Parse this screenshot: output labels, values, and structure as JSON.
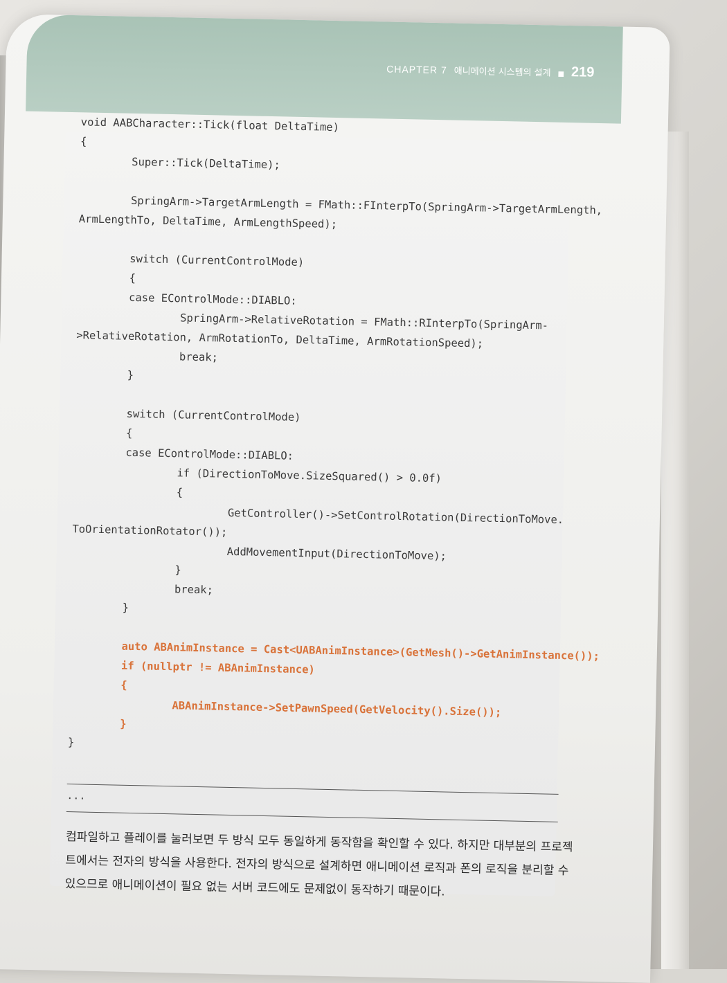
{
  "header": {
    "chapter_label": "CHAPTER 7",
    "chapter_title": "애니메이션 시스템의 설계",
    "separator": "■",
    "page_number": "219"
  },
  "code": [
    {
      "text": "void AABCharacter::Tick(float DeltaTime)",
      "highlight": false
    },
    {
      "text": "{",
      "highlight": false
    },
    {
      "text": "        Super::Tick(DeltaTime);",
      "highlight": false
    },
    {
      "text": "",
      "highlight": false
    },
    {
      "text": "        SpringArm->TargetArmLength = FMath::FInterpTo(SpringArm->TargetArmLength,",
      "highlight": false
    },
    {
      "text": "ArmLengthTo, DeltaTime, ArmLengthSpeed);",
      "highlight": false
    },
    {
      "text": "",
      "highlight": false
    },
    {
      "text": "        switch (CurrentControlMode)",
      "highlight": false
    },
    {
      "text": "        {",
      "highlight": false
    },
    {
      "text": "        case EControlMode::DIABLO:",
      "highlight": false
    },
    {
      "text": "                SpringArm->RelativeRotation = FMath::RInterpTo(SpringArm-",
      "highlight": false
    },
    {
      "text": ">RelativeRotation, ArmRotationTo, DeltaTime, ArmRotationSpeed);",
      "highlight": false
    },
    {
      "text": "                break;",
      "highlight": false
    },
    {
      "text": "        }",
      "highlight": false
    },
    {
      "text": "",
      "highlight": false
    },
    {
      "text": "        switch (CurrentControlMode)",
      "highlight": false
    },
    {
      "text": "        {",
      "highlight": false
    },
    {
      "text": "        case EControlMode::DIABLO:",
      "highlight": false
    },
    {
      "text": "                if (DirectionToMove.SizeSquared() > 0.0f)",
      "highlight": false
    },
    {
      "text": "                {",
      "highlight": false
    },
    {
      "text": "                        GetController()->SetControlRotation(DirectionToMove.",
      "highlight": false
    },
    {
      "text": "ToOrientationRotator());",
      "highlight": false
    },
    {
      "text": "                        AddMovementInput(DirectionToMove);",
      "highlight": false
    },
    {
      "text": "                }",
      "highlight": false
    },
    {
      "text": "                break;",
      "highlight": false
    },
    {
      "text": "        }",
      "highlight": false
    },
    {
      "text": "",
      "highlight": false
    },
    {
      "text": "        auto ABAnimInstance = Cast<UABAnimInstance>(GetMesh()->GetAnimInstance());",
      "highlight": true
    },
    {
      "text": "        if (nullptr != ABAnimInstance)",
      "highlight": true
    },
    {
      "text": "        {",
      "highlight": true
    },
    {
      "text": "                ABAnimInstance->SetPawnSpeed(GetVelocity().Size());",
      "highlight": true
    },
    {
      "text": "        }",
      "highlight": true
    },
    {
      "text": "}",
      "highlight": false
    }
  ],
  "ellipsis": "...",
  "body_lines": [
    "컴파일하고 플레이를 눌러보면 두 방식 모두 동일하게 동작함을 확인할 수 있다. 하지만 대부분의 프로젝",
    "트에서는 전자의 방식을 사용한다. 전자의 방식으로 설계하면 애니메이션 로직과 폰의 로직을 분리할 수",
    "있으므로 애니메이션이 필요 없는 서버 코드에도 문제없이 동작하기 때문이다."
  ],
  "colors": {
    "header_band": "#a9c3b6",
    "highlight_code": "#d9733a",
    "spine": "#2f5aa6"
  }
}
